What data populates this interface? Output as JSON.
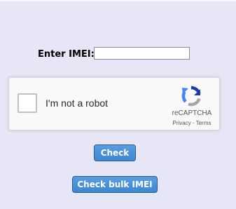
{
  "form": {
    "imei_label": "Enter IMEI:",
    "imei_value": ""
  },
  "recaptcha": {
    "label": "I'm not a robot",
    "brand": "reCAPTCHA",
    "privacy_link": "Privacy",
    "separator": " - ",
    "terms_link": "Terms"
  },
  "buttons": {
    "check_label": "Check",
    "bulk_label": "Check bulk IMEI"
  },
  "colors": {
    "background": "#e6e6f6",
    "button": "#4a90d9"
  },
  "icons": {
    "recaptcha_logo": "recaptcha-logo-icon"
  }
}
